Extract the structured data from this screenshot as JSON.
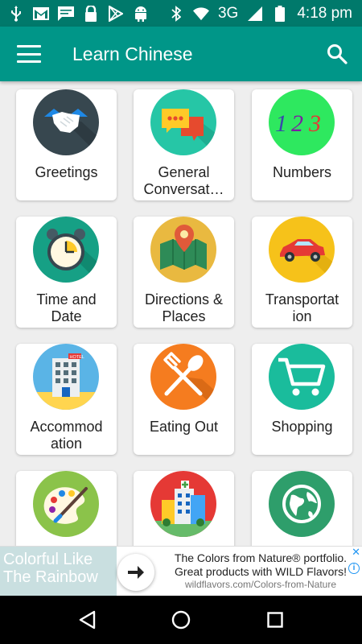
{
  "status_bar": {
    "network": "3G",
    "time": "4:18 pm",
    "left_icons": [
      "usb-icon",
      "gmail-icon",
      "message-icon",
      "lock-icon",
      "play-store-icon",
      "android-icon"
    ],
    "right_icons": [
      "bluetooth-icon",
      "wifi-icon",
      "signal-icon",
      "battery-icon"
    ]
  },
  "app_bar": {
    "title": "Learn Chinese",
    "menu_icon": "hamburger-menu-icon",
    "search_icon": "search-icon",
    "color": "#009688",
    "status_color": "#00796b"
  },
  "categories": [
    {
      "label": "Greetings",
      "icon": "handshake-icon",
      "color": "#37474f"
    },
    {
      "label": "General Conversat…",
      "icon": "chat-bubbles-icon",
      "color": "#26c6a6"
    },
    {
      "label": "Numbers",
      "icon": "numbers-123-icon",
      "color": "#2ee85f"
    },
    {
      "label": "Time and Date",
      "icon": "alarm-clock-icon",
      "color": "#16a085"
    },
    {
      "label": "Directions & Places",
      "icon": "map-pin-icon",
      "color": "#e9b940"
    },
    {
      "label": "Transportation",
      "icon": "car-icon",
      "color": "#f6c21a"
    },
    {
      "label": "Accommodation",
      "icon": "hotel-icon",
      "color": "#5ab4e6"
    },
    {
      "label": "Eating Out",
      "icon": "fork-spoon-icon",
      "color": "#f57c1f"
    },
    {
      "label": "Shopping",
      "icon": "shopping-cart-icon",
      "color": "#1abc9c"
    },
    {
      "label": "",
      "icon": "paint-palette-icon",
      "color": "#8bc34a"
    },
    {
      "label": "",
      "icon": "hospital-icon",
      "color": "#e53935"
    },
    {
      "label": "",
      "icon": "globe-icon",
      "color": "#2e9e6b"
    }
  ],
  "labels_display": {
    "greetings": "Greetings",
    "general": "General Conversat…",
    "numbers": "Numbers",
    "time": "Time and Date",
    "directions": "Directions & Places",
    "transport": "Transportat ion",
    "accommodation": "Accommod ation",
    "eating": "Eating Out",
    "shopping": "Shopping"
  },
  "ad": {
    "left_text": "Colorful Like The Rainbow",
    "line1": "The Colors from Nature® portfolio.",
    "line2": "Great products with WILD Flavors!",
    "url": "wildflavors.com/Colors-from-Nature",
    "info": "i",
    "close": "✕"
  },
  "nav_bar": {
    "back_icon": "back-triangle-icon",
    "home_icon": "home-circle-icon",
    "recents_icon": "recents-square-icon"
  }
}
